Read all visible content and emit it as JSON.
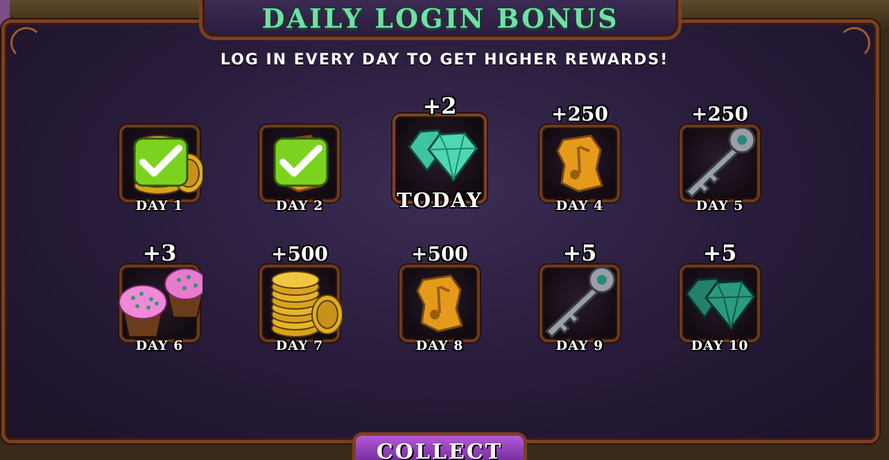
{
  "header": {
    "title": "DAILY LOGIN BONUS",
    "subtitle": "LOG IN EVERY DAY TO GET HIGHER REWARDS!"
  },
  "rewards": [
    {
      "day_label": "DAY 1",
      "amount": "",
      "icon": "coins-icon",
      "claimed": true
    },
    {
      "day_label": "DAY 2",
      "amount": "",
      "icon": "shards-icon",
      "claimed": true
    },
    {
      "day_label": "TODAY",
      "amount": "+2",
      "icon": "diamonds-icon",
      "claimed": false,
      "today": true
    },
    {
      "day_label": "DAY 4",
      "amount": "+250",
      "icon": "shards-icon",
      "claimed": false
    },
    {
      "day_label": "DAY 5",
      "amount": "+250",
      "icon": "key-icon",
      "claimed": false
    },
    {
      "day_label": "DAY 6",
      "amount": "+3",
      "icon": "cupcakes-icon",
      "claimed": false
    },
    {
      "day_label": "DAY 7",
      "amount": "+500",
      "icon": "coins-icon",
      "claimed": false
    },
    {
      "day_label": "DAY 8",
      "amount": "+500",
      "icon": "shards-icon",
      "claimed": false
    },
    {
      "day_label": "DAY 9",
      "amount": "+5",
      "icon": "key-icon",
      "claimed": false
    },
    {
      "day_label": "DAY 10",
      "amount": "+5",
      "icon": "diamonds-icon",
      "claimed": false
    }
  ],
  "footer": {
    "collect_label": "COLLECT"
  },
  "colors": {
    "title": "#6fe0a7",
    "panel": "#2a1d3d",
    "frame": "#7a3f22",
    "check": "#8ee02a",
    "button": "#9a44c4"
  }
}
